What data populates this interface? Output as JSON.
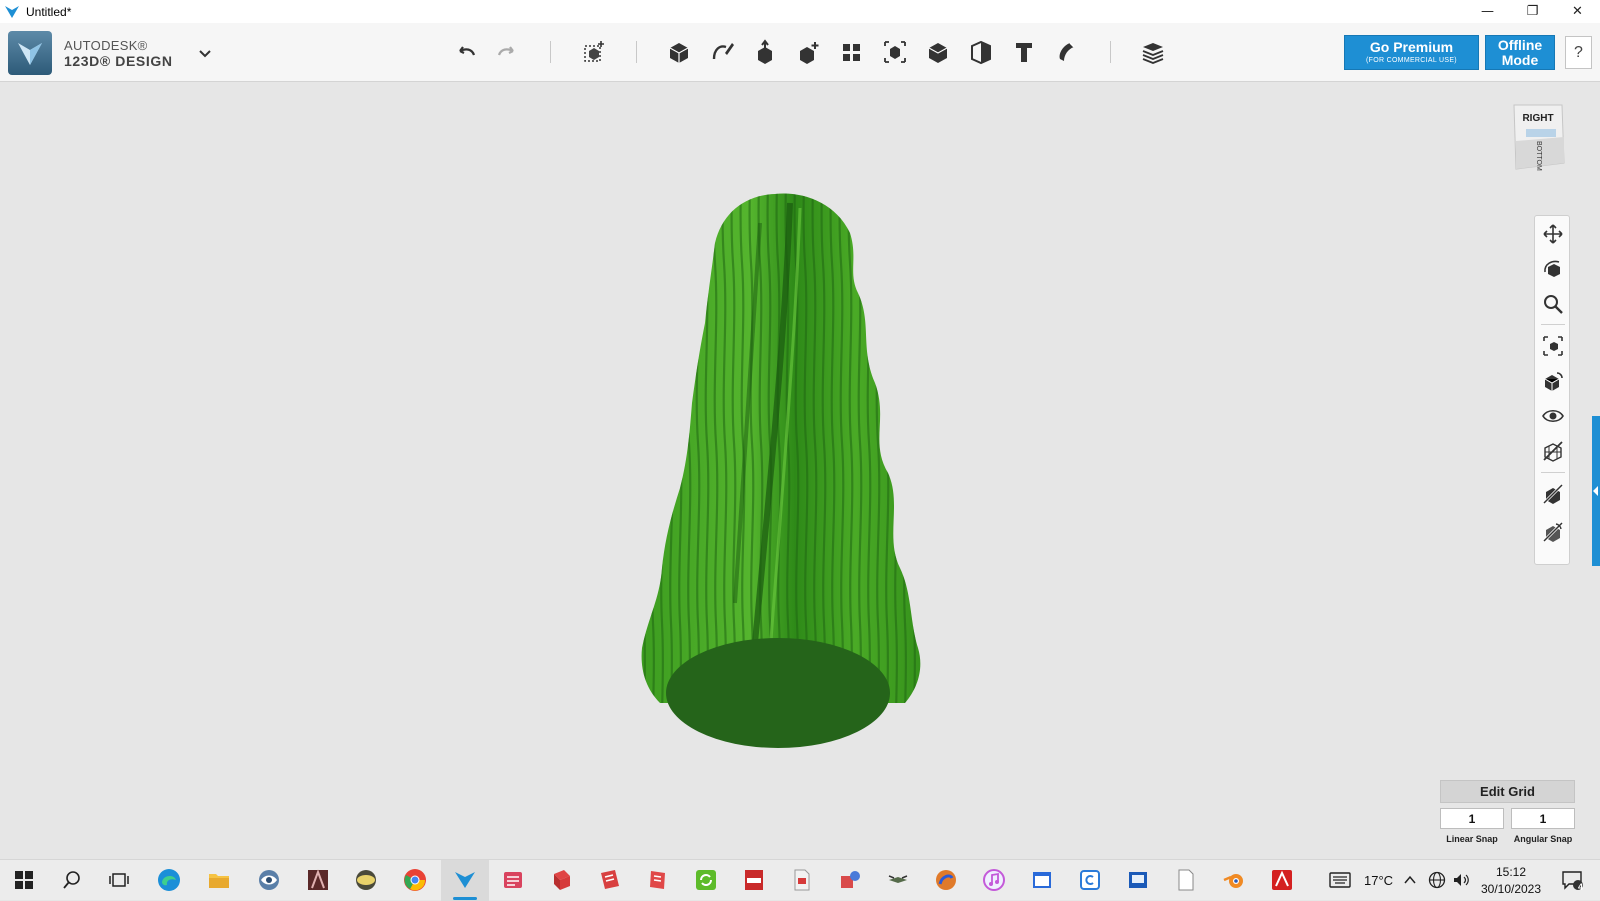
{
  "window": {
    "title": "Untitled*",
    "controls": {
      "minimize": "—",
      "restore": "❐",
      "close": "✕"
    }
  },
  "brand": {
    "line1": "AUTODESK®",
    "line2": "123D® DESIGN"
  },
  "toolbar": {
    "tools": [
      "undo-icon",
      "redo-icon",
      "new-primitive-icon",
      "primitives-icon",
      "sketch-icon",
      "construct-icon",
      "modify-icon",
      "pattern-icon",
      "grouping-icon",
      "combine-icon",
      "measure-icon",
      "text-icon",
      "snap-icon",
      "materials-icon"
    ]
  },
  "premium": {
    "label": "Go Premium",
    "sub": "(FOR COMMERCIAL USE)"
  },
  "offline": {
    "line1": "Offline",
    "line2": "Mode"
  },
  "help": {
    "label": "?"
  },
  "viewcube": {
    "front": "RIGHT",
    "bottom": "BOTTOM"
  },
  "nav_panel": {
    "tools": [
      "pan-icon",
      "orbit-icon",
      "zoom-icon",
      "fit-icon",
      "views-icon",
      "visibility-icon",
      "material-outline-icon",
      "show-hide-icon",
      "physical-material-icon"
    ]
  },
  "grid": {
    "edit_label": "Edit Grid",
    "linear_snap": "1",
    "angular_snap": "1",
    "linear_label": "Linear Snap",
    "angular_label": "Angular Snap"
  },
  "model": {
    "color_light": "#55b52e",
    "color_mid": "#3a9a1e",
    "color_dark": "#1f6613",
    "base_color": "#25641a"
  },
  "taskbar": {
    "weather": "17°C",
    "time": "15:12",
    "date": "30/10/2023",
    "notifications": "4"
  },
  "colors": {
    "accent": "#1e8fd4"
  }
}
